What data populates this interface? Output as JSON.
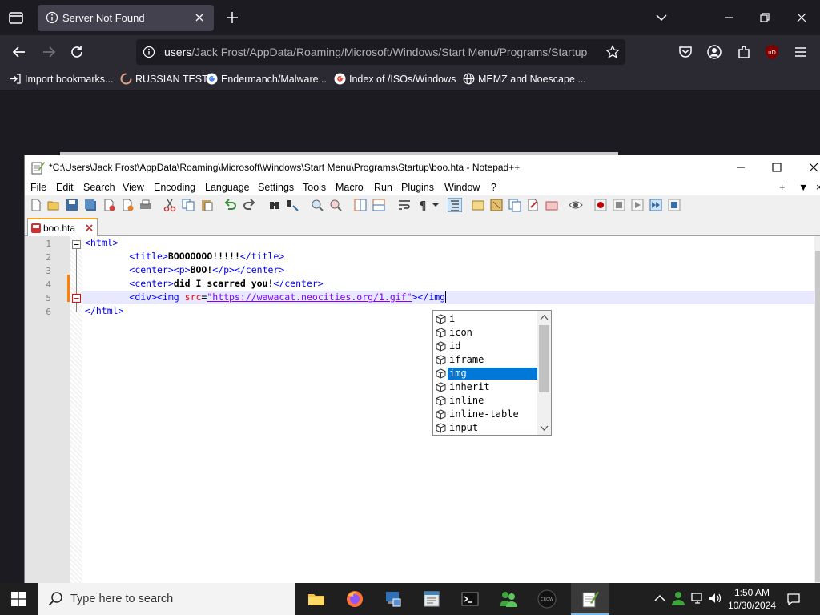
{
  "browser": {
    "tab_title": "Server Not Found",
    "url_scheme": "users",
    "url_path": "/Jack Frost/AppData/Roaming/Microsoft/Windows/Start Menu/Programs/Startup",
    "bookmarks": [
      {
        "label": "Import bookmarks...",
        "icon": "import-icon"
      },
      {
        "label": "RUSSIAN TEST",
        "icon": "loading-icon"
      },
      {
        "label": "Endermanch/Malware...",
        "icon": "google-icon"
      },
      {
        "label": "Index of /ISOs/Windows",
        "icon": "google-icon"
      },
      {
        "label": "MEMZ and Noescape ...",
        "icon": "globe-icon"
      }
    ]
  },
  "npp": {
    "title": "*C:\\Users\\Jack Frost\\AppData\\Roaming\\Microsoft\\Windows\\Start Menu\\Programs\\Startup\\boo.hta - Notepad++",
    "menus": [
      "File",
      "Edit",
      "Search",
      "View",
      "Encoding",
      "Language",
      "Settings",
      "Tools",
      "Macro",
      "Run",
      "Plugins",
      "Window",
      "?"
    ],
    "menu_right": [
      "+",
      "▼",
      "×"
    ],
    "file_tab": "boo.hta",
    "line_numbers": [
      "1",
      "2",
      "3",
      "4",
      "5",
      "6"
    ],
    "code": {
      "l1": "<html>",
      "l2_open": "<title>",
      "l2_text": "BOOOOOOO!!!!!",
      "l2_close": "</title>",
      "l3_open": "<center><p>",
      "l3_text": "BOO!",
      "l3_close": "</p></center>",
      "l4_open": "<center>",
      "l4_text": "did I scarred you!",
      "l4_close": "</center>",
      "l5_tag": "<div><img ",
      "l5_attr": "src",
      "l5_eq": "=",
      "l5_val": "\"https://wawacat.neocities.org/1.gif\"",
      "l5_end": "></img",
      "l6": "</html>"
    },
    "autocomplete": [
      "i",
      "icon",
      "id",
      "iframe",
      "img",
      "inherit",
      "inline",
      "inline-table",
      "input"
    ],
    "autocomplete_selected": "img"
  },
  "taskbar": {
    "search_placeholder": "Type here to search",
    "apps": [
      "file-explorer-icon",
      "firefox-icon",
      "device-manager-icon",
      "notepad-icon",
      "terminal-icon",
      "users-icon",
      "crow-icon",
      "notepadpp-icon"
    ],
    "time": "1:50 AM",
    "date": "10/30/2024"
  },
  "colors": {
    "accent": "#0078d7",
    "firefox_bg": "#1c1b22",
    "tag_blue": "#0000ff",
    "attr_red": "#ff0000",
    "string_purple": "#8000ff"
  }
}
